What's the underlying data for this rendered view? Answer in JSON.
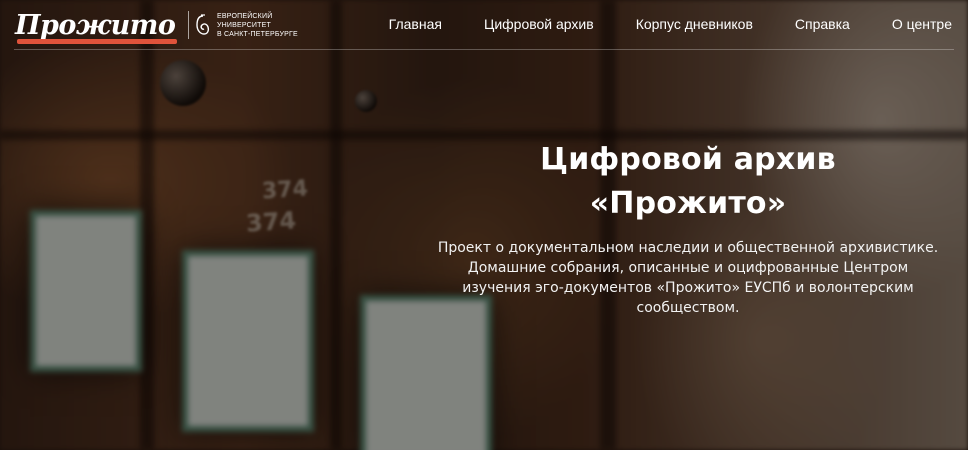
{
  "header": {
    "logo_text": "Прожито",
    "partner": {
      "line1": "Европейский",
      "line2": "университет",
      "line3": "в Санкт-Петербурге"
    },
    "nav": [
      {
        "label": "Главная"
      },
      {
        "label": "Цифровой архив"
      },
      {
        "label": "Корпус дневников"
      },
      {
        "label": "Справка"
      },
      {
        "label": "О центре"
      }
    ]
  },
  "hero": {
    "title_line1": "Цифровой архив",
    "title_line2": "«Прожито»",
    "description": "Проект о документальном наследии и общественной архивистике. Домашние собрания, описанные и оцифрованные Центром изучения эго-документов «Прожито» ЕУСПб и волонтерским сообществом.",
    "background_labels": [
      "374",
      "374"
    ]
  },
  "colors": {
    "accent": "#e0533b",
    "text": "#ffffff",
    "overlay": "rgba(0,0,0,0.38)"
  }
}
